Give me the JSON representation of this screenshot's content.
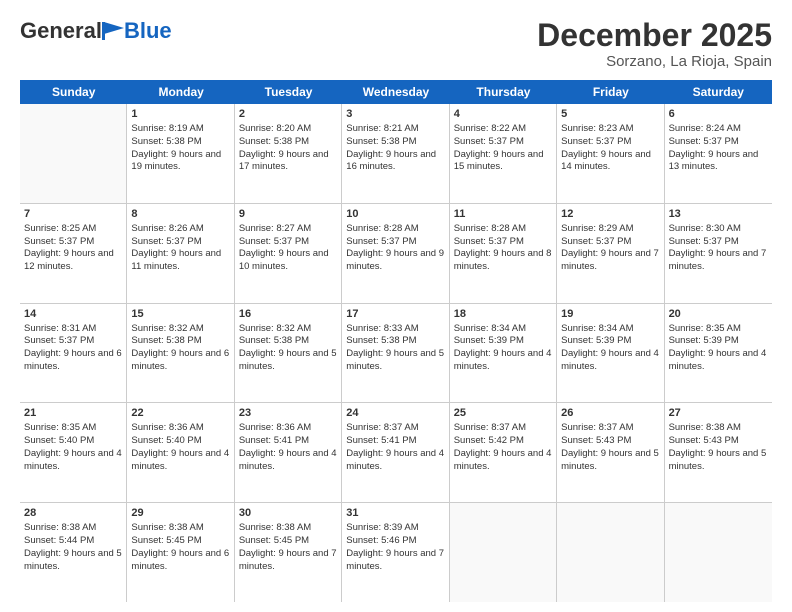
{
  "header": {
    "logo_general": "General",
    "logo_blue": "Blue",
    "month_title": "December 2025",
    "location": "Sorzano, La Rioja, Spain"
  },
  "days_of_week": [
    "Sunday",
    "Monday",
    "Tuesday",
    "Wednesday",
    "Thursday",
    "Friday",
    "Saturday"
  ],
  "weeks": [
    [
      {
        "day": "",
        "sunrise": "",
        "sunset": "",
        "daylight": "",
        "empty": true
      },
      {
        "day": "1",
        "sunrise": "Sunrise: 8:19 AM",
        "sunset": "Sunset: 5:38 PM",
        "daylight": "Daylight: 9 hours and 19 minutes."
      },
      {
        "day": "2",
        "sunrise": "Sunrise: 8:20 AM",
        "sunset": "Sunset: 5:38 PM",
        "daylight": "Daylight: 9 hours and 17 minutes."
      },
      {
        "day": "3",
        "sunrise": "Sunrise: 8:21 AM",
        "sunset": "Sunset: 5:38 PM",
        "daylight": "Daylight: 9 hours and 16 minutes."
      },
      {
        "day": "4",
        "sunrise": "Sunrise: 8:22 AM",
        "sunset": "Sunset: 5:37 PM",
        "daylight": "Daylight: 9 hours and 15 minutes."
      },
      {
        "day": "5",
        "sunrise": "Sunrise: 8:23 AM",
        "sunset": "Sunset: 5:37 PM",
        "daylight": "Daylight: 9 hours and 14 minutes."
      },
      {
        "day": "6",
        "sunrise": "Sunrise: 8:24 AM",
        "sunset": "Sunset: 5:37 PM",
        "daylight": "Daylight: 9 hours and 13 minutes."
      }
    ],
    [
      {
        "day": "7",
        "sunrise": "Sunrise: 8:25 AM",
        "sunset": "Sunset: 5:37 PM",
        "daylight": "Daylight: 9 hours and 12 minutes."
      },
      {
        "day": "8",
        "sunrise": "Sunrise: 8:26 AM",
        "sunset": "Sunset: 5:37 PM",
        "daylight": "Daylight: 9 hours and 11 minutes."
      },
      {
        "day": "9",
        "sunrise": "Sunrise: 8:27 AM",
        "sunset": "Sunset: 5:37 PM",
        "daylight": "Daylight: 9 hours and 10 minutes."
      },
      {
        "day": "10",
        "sunrise": "Sunrise: 8:28 AM",
        "sunset": "Sunset: 5:37 PM",
        "daylight": "Daylight: 9 hours and 9 minutes."
      },
      {
        "day": "11",
        "sunrise": "Sunrise: 8:28 AM",
        "sunset": "Sunset: 5:37 PM",
        "daylight": "Daylight: 9 hours and 8 minutes."
      },
      {
        "day": "12",
        "sunrise": "Sunrise: 8:29 AM",
        "sunset": "Sunset: 5:37 PM",
        "daylight": "Daylight: 9 hours and 7 minutes."
      },
      {
        "day": "13",
        "sunrise": "Sunrise: 8:30 AM",
        "sunset": "Sunset: 5:37 PM",
        "daylight": "Daylight: 9 hours and 7 minutes."
      }
    ],
    [
      {
        "day": "14",
        "sunrise": "Sunrise: 8:31 AM",
        "sunset": "Sunset: 5:37 PM",
        "daylight": "Daylight: 9 hours and 6 minutes."
      },
      {
        "day": "15",
        "sunrise": "Sunrise: 8:32 AM",
        "sunset": "Sunset: 5:38 PM",
        "daylight": "Daylight: 9 hours and 6 minutes."
      },
      {
        "day": "16",
        "sunrise": "Sunrise: 8:32 AM",
        "sunset": "Sunset: 5:38 PM",
        "daylight": "Daylight: 9 hours and 5 minutes."
      },
      {
        "day": "17",
        "sunrise": "Sunrise: 8:33 AM",
        "sunset": "Sunset: 5:38 PM",
        "daylight": "Daylight: 9 hours and 5 minutes."
      },
      {
        "day": "18",
        "sunrise": "Sunrise: 8:34 AM",
        "sunset": "Sunset: 5:39 PM",
        "daylight": "Daylight: 9 hours and 4 minutes."
      },
      {
        "day": "19",
        "sunrise": "Sunrise: 8:34 AM",
        "sunset": "Sunset: 5:39 PM",
        "daylight": "Daylight: 9 hours and 4 minutes."
      },
      {
        "day": "20",
        "sunrise": "Sunrise: 8:35 AM",
        "sunset": "Sunset: 5:39 PM",
        "daylight": "Daylight: 9 hours and 4 minutes."
      }
    ],
    [
      {
        "day": "21",
        "sunrise": "Sunrise: 8:35 AM",
        "sunset": "Sunset: 5:40 PM",
        "daylight": "Daylight: 9 hours and 4 minutes."
      },
      {
        "day": "22",
        "sunrise": "Sunrise: 8:36 AM",
        "sunset": "Sunset: 5:40 PM",
        "daylight": "Daylight: 9 hours and 4 minutes."
      },
      {
        "day": "23",
        "sunrise": "Sunrise: 8:36 AM",
        "sunset": "Sunset: 5:41 PM",
        "daylight": "Daylight: 9 hours and 4 minutes."
      },
      {
        "day": "24",
        "sunrise": "Sunrise: 8:37 AM",
        "sunset": "Sunset: 5:41 PM",
        "daylight": "Daylight: 9 hours and 4 minutes."
      },
      {
        "day": "25",
        "sunrise": "Sunrise: 8:37 AM",
        "sunset": "Sunset: 5:42 PM",
        "daylight": "Daylight: 9 hours and 4 minutes."
      },
      {
        "day": "26",
        "sunrise": "Sunrise: 8:37 AM",
        "sunset": "Sunset: 5:43 PM",
        "daylight": "Daylight: 9 hours and 5 minutes."
      },
      {
        "day": "27",
        "sunrise": "Sunrise: 8:38 AM",
        "sunset": "Sunset: 5:43 PM",
        "daylight": "Daylight: 9 hours and 5 minutes."
      }
    ],
    [
      {
        "day": "28",
        "sunrise": "Sunrise: 8:38 AM",
        "sunset": "Sunset: 5:44 PM",
        "daylight": "Daylight: 9 hours and 5 minutes."
      },
      {
        "day": "29",
        "sunrise": "Sunrise: 8:38 AM",
        "sunset": "Sunset: 5:45 PM",
        "daylight": "Daylight: 9 hours and 6 minutes."
      },
      {
        "day": "30",
        "sunrise": "Sunrise: 8:38 AM",
        "sunset": "Sunset: 5:45 PM",
        "daylight": "Daylight: 9 hours and 7 minutes."
      },
      {
        "day": "31",
        "sunrise": "Sunrise: 8:39 AM",
        "sunset": "Sunset: 5:46 PM",
        "daylight": "Daylight: 9 hours and 7 minutes."
      },
      {
        "day": "",
        "sunrise": "",
        "sunset": "",
        "daylight": "",
        "empty": true
      },
      {
        "day": "",
        "sunrise": "",
        "sunset": "",
        "daylight": "",
        "empty": true
      },
      {
        "day": "",
        "sunrise": "",
        "sunset": "",
        "daylight": "",
        "empty": true
      }
    ]
  ]
}
